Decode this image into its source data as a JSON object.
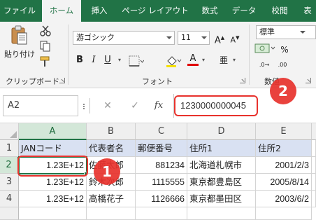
{
  "tabs": [
    "ファイル",
    "ホーム",
    "挿入",
    "ページ レイアウト",
    "数式",
    "データ",
    "校閲",
    "表"
  ],
  "active_tab": "ホーム",
  "ribbon": {
    "paste_label": "貼り付け",
    "clipboard_label": "クリップボード",
    "font_name": "游ゴシック",
    "font_size": "11",
    "font_group_label": "フォント",
    "number_format": "標準",
    "number_group_label": "数値",
    "bold": "B",
    "italic": "I",
    "underline": "U",
    "grow_font": "A",
    "shrink_font": "A",
    "font_color": "A",
    "phonetic": "亜"
  },
  "formula_bar": {
    "name_box": "A2",
    "fx_label": "fx",
    "value": "1230000000045"
  },
  "grid": {
    "columns": [
      "A",
      "B",
      "C",
      "D",
      "E"
    ],
    "rows": [
      "1",
      "2",
      "3",
      "4"
    ],
    "cells": [
      [
        "JANコード",
        "代表者名",
        "郵便番号",
        "住所1",
        "住所2"
      ],
      [
        "1.23E+12",
        "佐藤太郎",
        "881234",
        "北海道札幌市",
        "2001/2/3"
      ],
      [
        "1.23E+12",
        "鈴木次郎",
        "1115555",
        "東京都豊島区",
        "2005/8/14"
      ],
      [
        "1.23E+12",
        "高橋花子",
        "1126666",
        "東京都墨田区",
        "2003/6/2"
      ]
    ]
  },
  "annotations": {
    "badge1": "1",
    "badge2": "2"
  },
  "colors": {
    "accent": "#217346",
    "header_fill": "#d9e1f2",
    "highlight": "#e8322d"
  }
}
